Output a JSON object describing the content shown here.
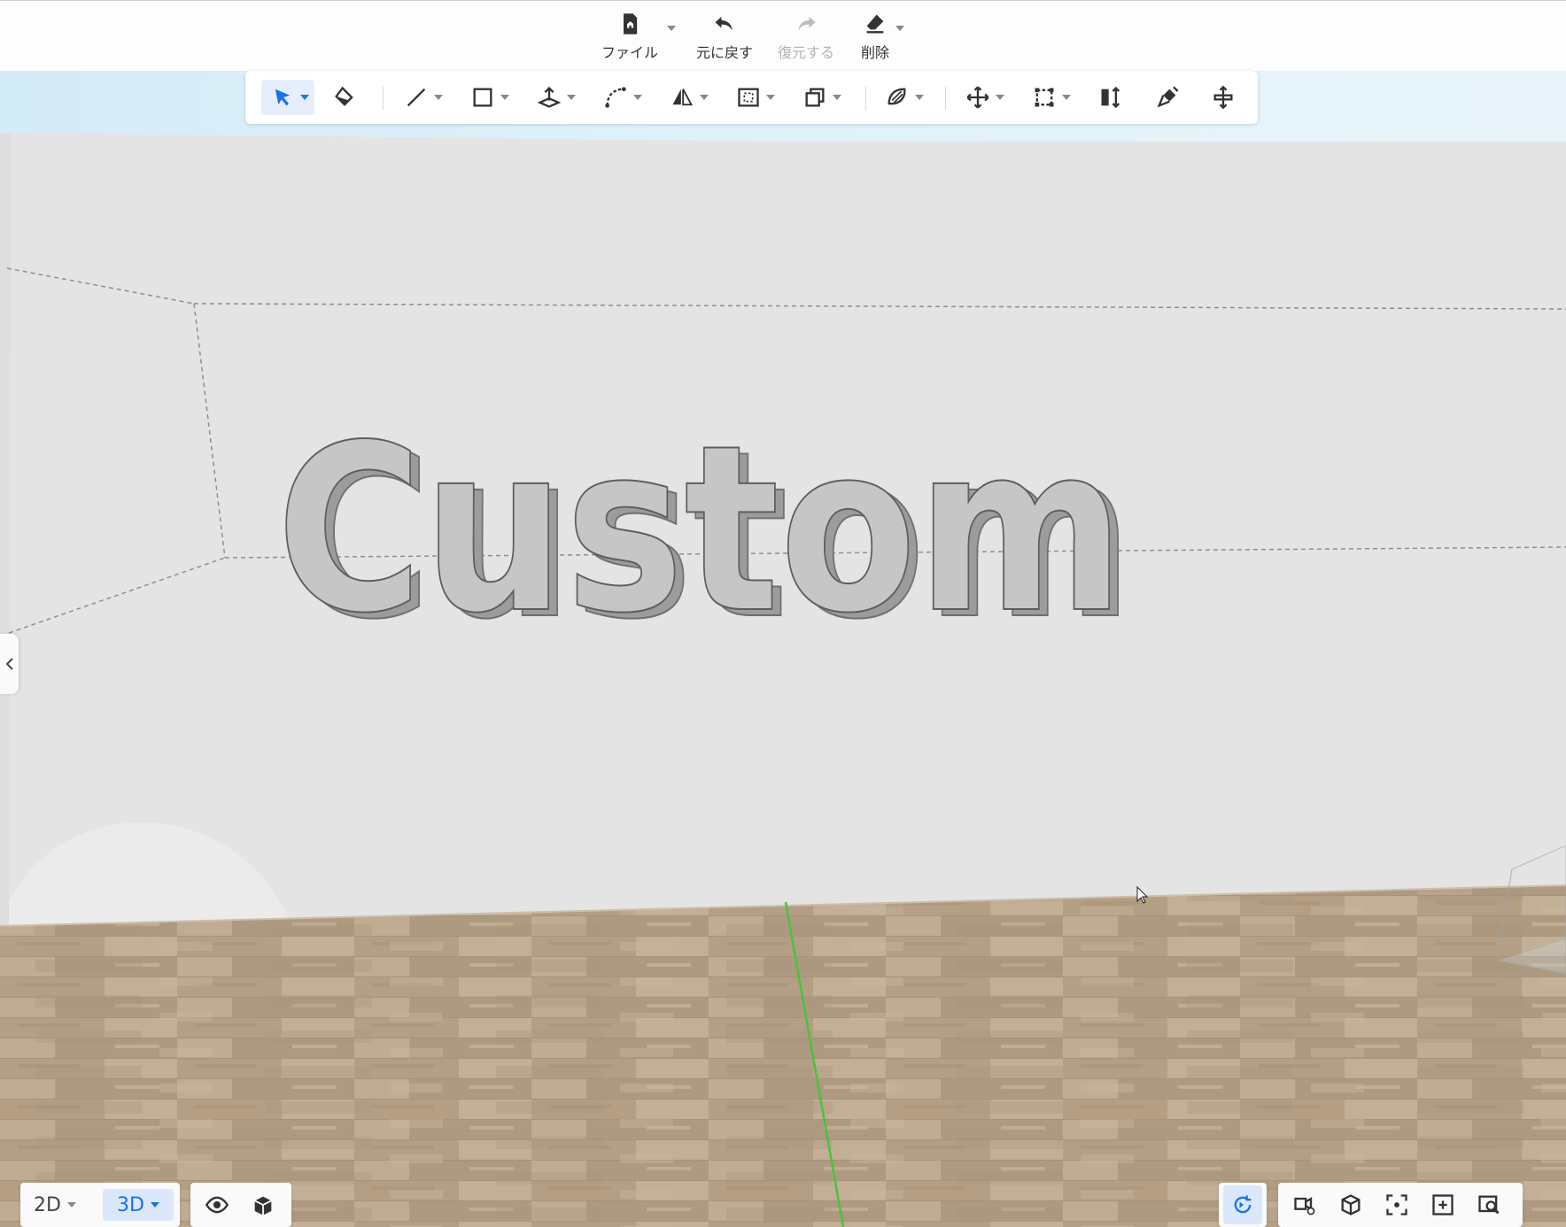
{
  "header": {
    "file_label": "ファイル",
    "undo_label": "元に戻す",
    "redo_label": "復元する",
    "delete_label": "削除"
  },
  "toolbar": {
    "tools": [
      "select-icon",
      "paint-bucket-icon",
      "line-icon",
      "rectangle-icon",
      "push-pull-icon",
      "arc-icon",
      "mirror-icon",
      "offset-icon",
      "copy-icon",
      "material-icon",
      "move-icon",
      "group-icon",
      "align-icon",
      "brush-icon",
      "stretch-icon"
    ]
  },
  "canvas": {
    "model_text": "Custom"
  },
  "view_controls": {
    "mode_2d": "2D",
    "mode_3d": "3D",
    "active_mode": "3D"
  },
  "colors": {
    "accent": "#1a73e8",
    "wall": "#e4e4e4",
    "floor": "#b9a58c",
    "axis_green": "#4cc23c"
  }
}
